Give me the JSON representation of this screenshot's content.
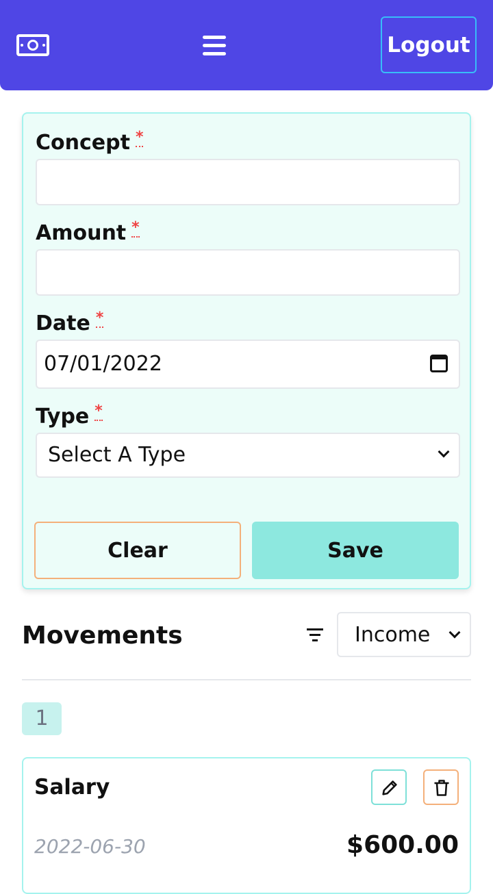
{
  "header": {
    "logo_icon": "money-bill-icon",
    "menu_icon": "hamburger-menu-icon",
    "logout_label": "Logout",
    "colors": {
      "background": "#4f46e5",
      "logout_border": "#38bdf8"
    }
  },
  "form": {
    "concept_label": "Concept",
    "concept_value": "",
    "amount_label": "Amount",
    "amount_value": "",
    "date_label": "Date",
    "date_value": "07/01/2022",
    "type_label": "Type",
    "type_selected": "Select A Type",
    "required_mark": "*",
    "clear_label": "Clear",
    "save_label": "Save"
  },
  "movements": {
    "title": "Movements",
    "filter_icon": "filter-icon",
    "filter_selected": "Income",
    "page": "1",
    "items": [
      {
        "concept": "Salary",
        "date": "2022-06-30",
        "amount": "$600.00"
      }
    ]
  }
}
